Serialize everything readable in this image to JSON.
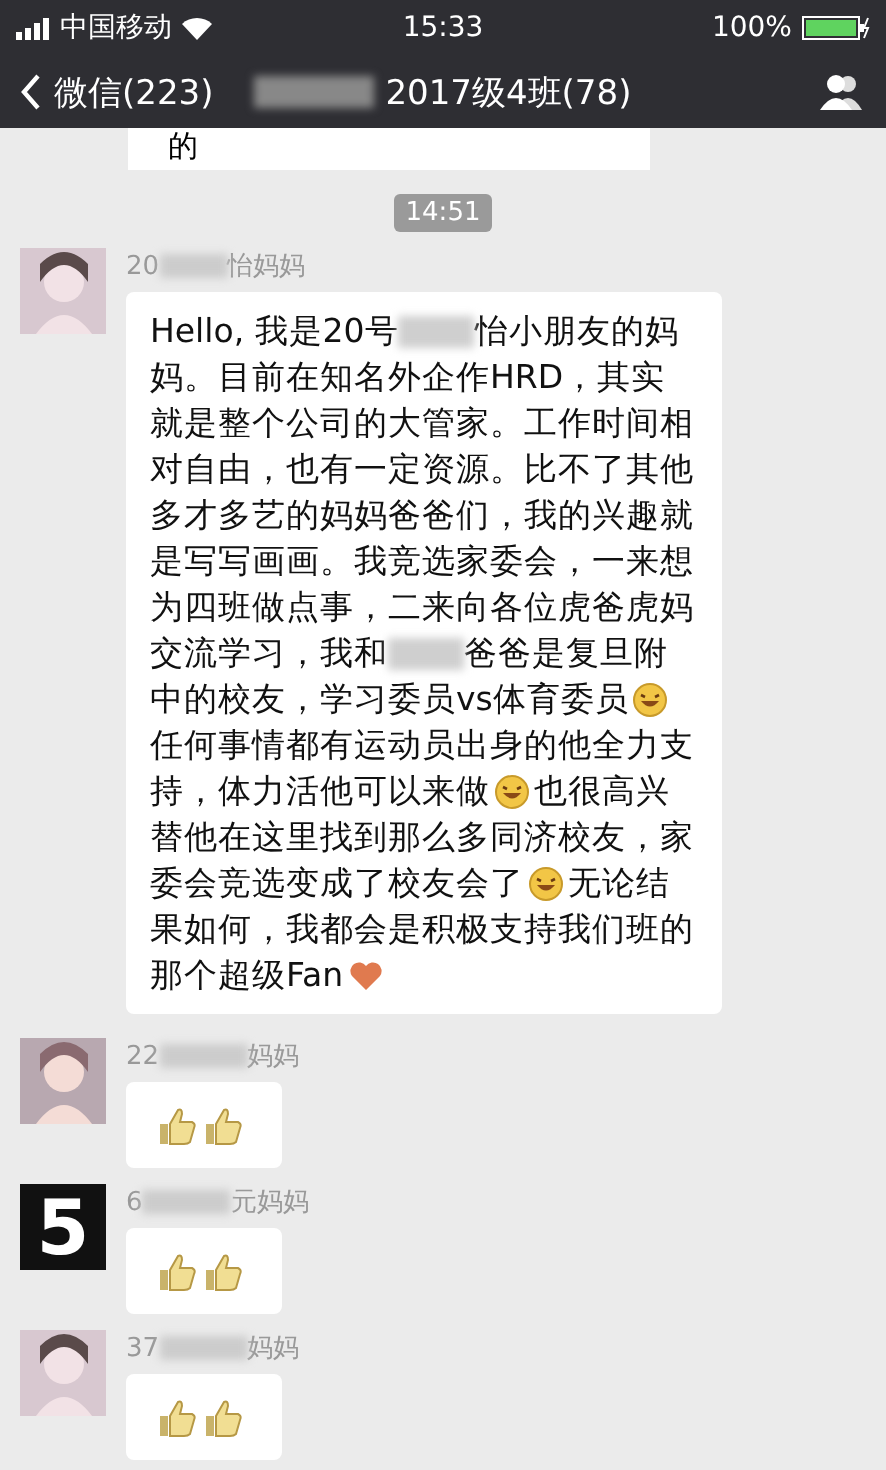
{
  "status_bar": {
    "carrier": "中国移动",
    "time": "15:33",
    "battery": "100%"
  },
  "nav": {
    "back": "微信(223)",
    "title": "2017级4班(78)"
  },
  "partial_message": {
    "text": "的"
  },
  "time_label": "14:51",
  "messages": [
    {
      "name_start": "20",
      "name_end": "怡妈妈",
      "segments": [
        {
          "kind": "text",
          "text": "Hello, 我是20号"
        },
        {
          "kind": "blur"
        },
        {
          "kind": "text",
          "text": "怡小朋友的妈妈。目前在知名外企作HRD，其实就是整个公司的大管家。工作时间相对自由，也有一定资源。比不了其他多才多艺的妈妈爸爸们，我的兴趣就是写写画画。我竞选家委会，一来想为四班做点事，二来向各位虎爸虎妈交流学习，我和"
        },
        {
          "kind": "blur"
        },
        {
          "kind": "text",
          "text": "爸爸是复旦附中的校友，学习委员vs体育委员"
        },
        {
          "kind": "smiley"
        },
        {
          "kind": "text",
          "text": "任何事情都有运动员出身的他全力支持，体力活他可以来做"
        },
        {
          "kind": "smiley"
        },
        {
          "kind": "text",
          "text": "也很高兴替他在这里找到那么多同济校友，家委会竞选变成了校友会了"
        },
        {
          "kind": "smiley"
        },
        {
          "kind": "text",
          "text": "无论结果如何，我都会是积极支持我们班的那个超级Fan"
        },
        {
          "kind": "heart"
        }
      ]
    },
    {
      "name_start": "22",
      "name_end": "妈妈",
      "segments": [
        {
          "kind": "thumbs"
        },
        {
          "kind": "thumbs"
        }
      ]
    },
    {
      "name_start": "6",
      "name_end": "元妈妈",
      "avatar": {
        "kind": "digit",
        "text": "5"
      },
      "segments": [
        {
          "kind": "thumbs"
        },
        {
          "kind": "thumbs"
        }
      ]
    },
    {
      "name_start": "37",
      "name_end": "妈妈",
      "segments": [
        {
          "kind": "thumbs"
        },
        {
          "kind": "thumbs"
        }
      ]
    }
  ]
}
